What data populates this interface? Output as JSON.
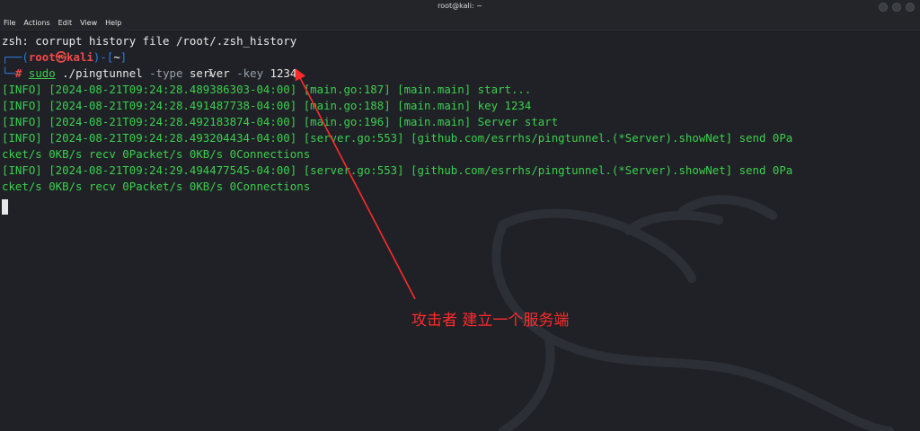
{
  "window": {
    "title": "root@kali: ~"
  },
  "menu": {
    "items": [
      "File",
      "Actions",
      "Edit",
      "View",
      "Help"
    ]
  },
  "terminal": {
    "line1": "zsh: corrupt history file /root/.zsh_history",
    "prompt": {
      "open": "┌──(",
      "user": "root",
      "at": "㉿",
      "host": "kali",
      "mid": ")-[",
      "dir": "~",
      "close": "]",
      "corner": "└─",
      "hash": "#"
    },
    "command": {
      "sudo": "sudo",
      "path": "./pingtunnel",
      "flag_type": "-type",
      "type_val": "server",
      "flag_key": "-key",
      "key_val": "1234"
    },
    "output": [
      "[INFO] [2024-08-21T09:24:28.489386303-04:00] [main.go:187] [main.main] start...",
      "[INFO] [2024-08-21T09:24:28.491487738-04:00] [main.go:188] [main.main] key 1234",
      "[INFO] [2024-08-21T09:24:28.492183874-04:00] [main.go:196] [main.main] Server start",
      "[INFO] [2024-08-21T09:24:28.493204434-04:00] [server.go:553] [github.com/esrrhs/pingtunnel.(*Server).showNet] send 0Pa",
      "cket/s 0KB/s recv 0Packet/s 0KB/s 0Connections",
      "[INFO] [2024-08-21T09:24:29.494477545-04:00] [server.go:553] [github.com/esrrhs/pingtunnel.(*Server).showNet] send 0Pa",
      "cket/s 0KB/s recv 0Packet/s 0KB/s 0Connections"
    ]
  },
  "annotation": {
    "text": "攻击者  建立一个服务端",
    "color": "#ff2b2b"
  }
}
